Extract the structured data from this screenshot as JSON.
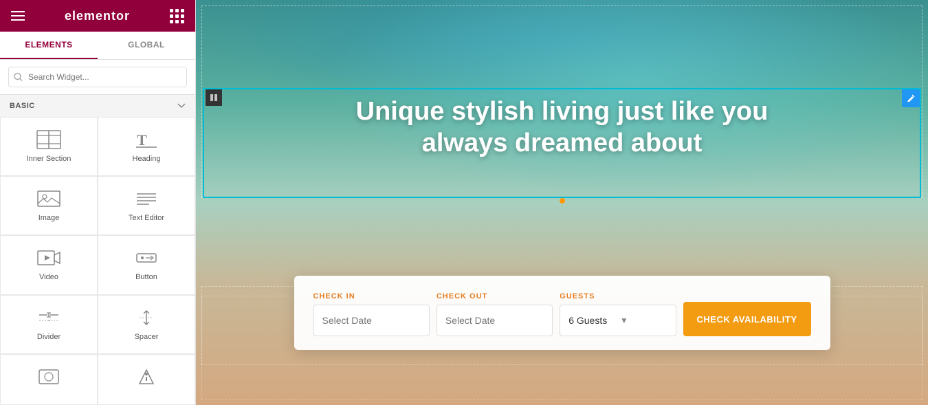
{
  "app": {
    "name": "elementor",
    "title": "Elementor"
  },
  "topbar": {
    "logo": "elementor",
    "hamburger_label": "menu",
    "grid_label": "grid-apps"
  },
  "tabs": [
    {
      "id": "elements",
      "label": "ELEMENTS",
      "active": true
    },
    {
      "id": "global",
      "label": "GLOBAL",
      "active": false
    }
  ],
  "search": {
    "placeholder": "Search Widget..."
  },
  "sections": {
    "basic": {
      "label": "BASIC"
    }
  },
  "widgets": [
    {
      "id": "inner-section",
      "label": "Inner Section",
      "icon": "inner-section-icon"
    },
    {
      "id": "heading",
      "label": "Heading",
      "icon": "heading-icon"
    },
    {
      "id": "image",
      "label": "Image",
      "icon": "image-icon"
    },
    {
      "id": "text-editor",
      "label": "Text Editor",
      "icon": "text-editor-icon"
    },
    {
      "id": "video",
      "label": "Video",
      "icon": "video-icon"
    },
    {
      "id": "button",
      "label": "Button",
      "icon": "button-icon"
    },
    {
      "id": "divider",
      "label": "Divider",
      "icon": "divider-icon"
    },
    {
      "id": "spacer",
      "label": "Spacer",
      "icon": "spacer-icon"
    },
    {
      "id": "icon1",
      "label": "",
      "icon": "icon1-icon"
    },
    {
      "id": "icon2",
      "label": "",
      "icon": "icon2-icon"
    }
  ],
  "canvas": {
    "hero_title_line1": "Unique stylish living just like you",
    "hero_title_line2": "always dreamed about",
    "booking_bar": {
      "checkin_label": "CHECK IN",
      "checkout_label": "CHECK OUT",
      "guests_label": "GUESTS",
      "checkin_placeholder": "Select Date",
      "checkout_placeholder": "Select Date",
      "guests_value": "6 Guests",
      "cta_label": "CHECK AVAILABILITY"
    }
  }
}
